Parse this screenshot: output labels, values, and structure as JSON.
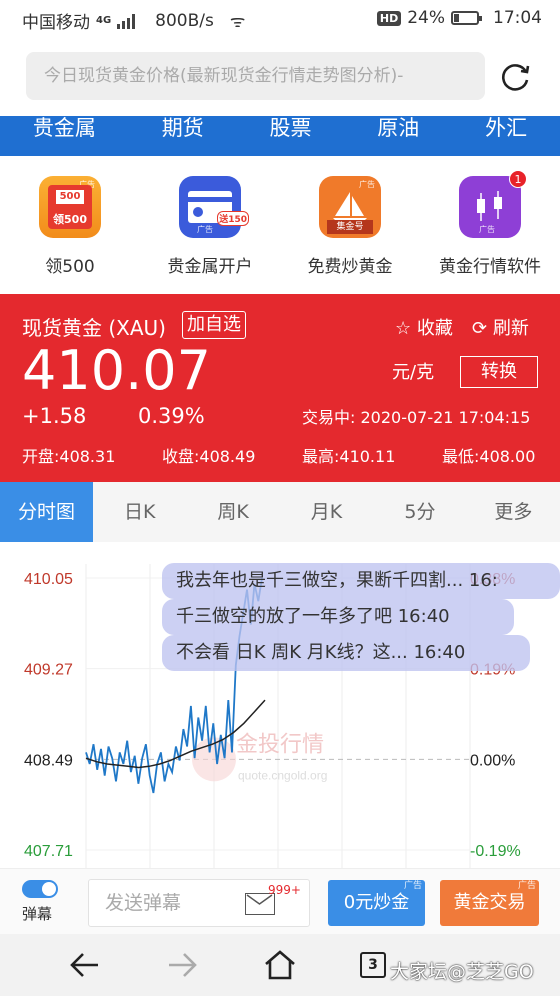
{
  "status_bar": {
    "carrier": "中国移动",
    "network": "4G",
    "speed": "800B/s",
    "battery": "24%",
    "time": "17:04"
  },
  "address_bar": {
    "url_text": "今日现货黄金价格(最新现货金行情走势图分析)-"
  },
  "top_nav": [
    "贵金属",
    "期货",
    "股票",
    "原油",
    "外汇"
  ],
  "apps": [
    {
      "label": "领500",
      "icon": "red-envelope-icon",
      "icon_text": "500",
      "sub_text": "领500",
      "color": "#f5a623"
    },
    {
      "label": "贵金属开户",
      "icon": "account-card-icon",
      "icon_text": "送150",
      "color": "#3b5bdb"
    },
    {
      "label": "免费炒黄金",
      "icon": "sailboat-icon",
      "icon_text": "集金号",
      "color": "#f07a2a"
    },
    {
      "label": "黄金行情软件",
      "icon": "candlestick-icon",
      "badge": "1",
      "color": "#8e3fd6"
    }
  ],
  "ad_tag": "广告",
  "quote": {
    "name": "现货黄金 (XAU)",
    "add_watch": "加自选",
    "favorite": "收藏",
    "refresh": "刷新",
    "price": "410.07",
    "unit": "元/克",
    "convert": "转换",
    "change": "+1.58",
    "change_pct": "0.39%",
    "trade_time": "交易中:  2020-07-21 17:04:15",
    "open": "开盘:408.31",
    "prev_close": "收盘:408.49",
    "high": "最高:410.11",
    "low": "最低:408.00"
  },
  "tabs": [
    "分时图",
    "日K",
    "周K",
    "月K",
    "5分",
    "更多"
  ],
  "chart_data": {
    "type": "line",
    "y_labels_left": [
      "410.05",
      "409.27",
      "408.49",
      "407.71"
    ],
    "y_labels_right": [
      "0.38%",
      "0.19%",
      "0.00%",
      "-0.19%"
    ],
    "ylim": [
      407.71,
      410.05
    ],
    "baseline": 408.49,
    "watermark_cn": "金投行情",
    "watermark_url": "quote.cngold.org",
    "series": [
      {
        "color": "#1f78c8",
        "values": [
          408.55,
          408.45,
          408.62,
          408.4,
          408.58,
          408.35,
          408.6,
          408.5,
          408.3,
          408.55,
          408.45,
          408.65,
          408.38,
          408.52,
          408.28,
          408.5,
          408.62,
          408.35,
          408.2,
          408.45,
          408.55,
          408.3,
          408.45,
          408.38,
          408.6,
          408.48,
          408.75,
          408.6,
          408.95,
          408.5,
          408.85,
          408.65,
          408.95,
          408.55,
          408.8,
          408.45,
          408.7,
          408.5,
          409.0,
          408.55,
          409.3,
          409.55,
          409.75,
          409.95,
          409.65,
          410.0,
          409.85,
          410.05
        ]
      },
      {
        "color": "#222222",
        "values": [
          408.5,
          408.47,
          408.45,
          408.44,
          408.43,
          408.42,
          408.43,
          408.45,
          408.48,
          408.52,
          408.56,
          408.59,
          408.62,
          408.66,
          408.72,
          408.8,
          408.9,
          409.0
        ]
      }
    ]
  },
  "danmu": [
    "我去年也是千三做空，果断千四割...  16:",
    "千三做空的放了一年多了吧  16:40",
    "不会看 日K 周K 月K线？这...  16:40"
  ],
  "bottom_bar": {
    "toggle_label": "弹幕",
    "input_placeholder": "发送弹幕",
    "count": "999+",
    "btn_primary": "0元炒金",
    "btn_secondary": "黄金交易"
  },
  "browser_nav": {
    "tabs_count": "3",
    "watermark": "大家坛@芝芝GO"
  }
}
